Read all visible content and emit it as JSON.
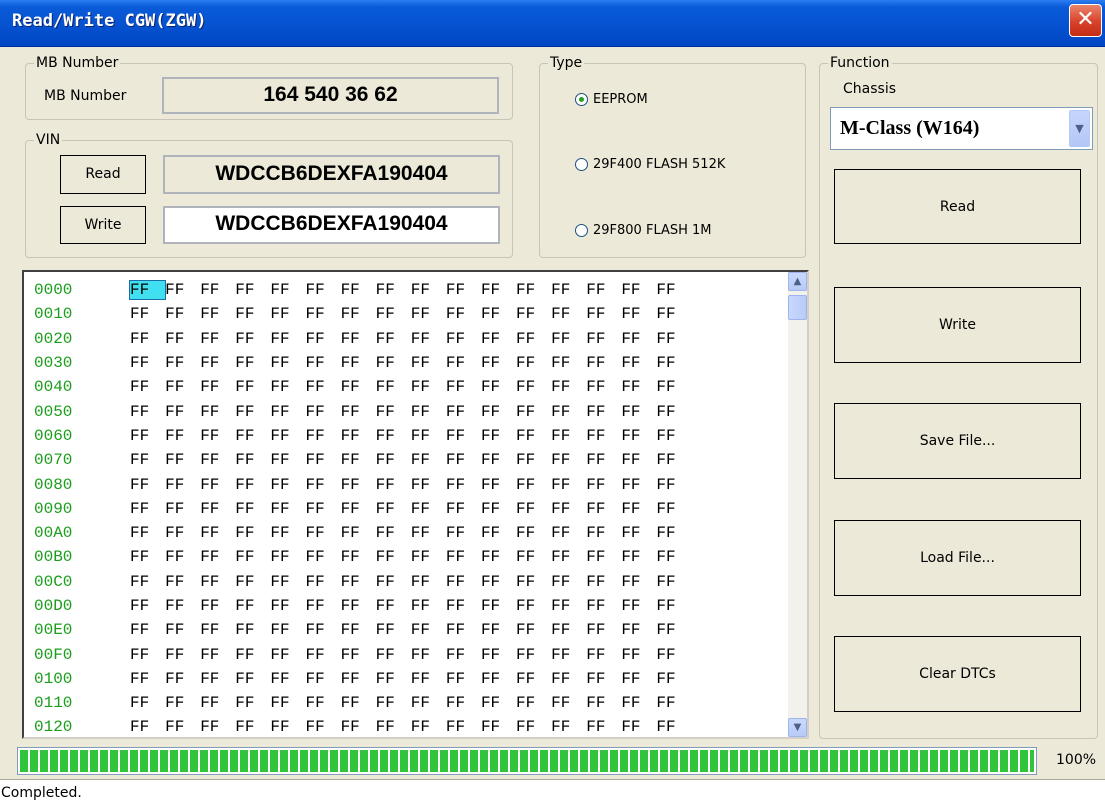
{
  "window": {
    "title": "Read/Write CGW(ZGW)",
    "close_glyph": "✕"
  },
  "mb_number": {
    "group_label": "MB Number",
    "label": "MB Number",
    "value": "164 540 36 62"
  },
  "vin": {
    "group_label": "VIN",
    "read_label": "Read",
    "write_label": "Write",
    "read_value": "WDCCB6DEXFA190404",
    "write_value": "WDCCB6DEXFA190404"
  },
  "type": {
    "group_label": "Type",
    "options": [
      {
        "label": "EEPROM",
        "selected": true
      },
      {
        "label": "29F400 FLASH 512K",
        "selected": false
      },
      {
        "label": "29F800 FLASH 1M",
        "selected": false
      }
    ]
  },
  "function": {
    "group_label": "Function",
    "chassis_label": "Chassis",
    "chassis_value": "M-Class (W164)",
    "buttons": [
      "Read",
      "Write",
      "Save File...",
      "Load File...",
      "Clear DTCs"
    ]
  },
  "hex": {
    "addresses": [
      "0000",
      "0010",
      "0020",
      "0030",
      "0040",
      "0050",
      "0060",
      "0070",
      "0080",
      "0090",
      "00A0",
      "00B0",
      "00C0",
      "00D0",
      "00E0",
      "00F0",
      "0100",
      "0110",
      "0120"
    ],
    "byte_value": "FF",
    "bytes_per_row": 16,
    "selected": {
      "row": 0,
      "col": 0
    },
    "colors": {
      "address": "#1a9d1a",
      "selection": "#40e0f0"
    }
  },
  "progress": {
    "value": 1.0,
    "label": "100%"
  },
  "status": {
    "text": "Completed."
  }
}
